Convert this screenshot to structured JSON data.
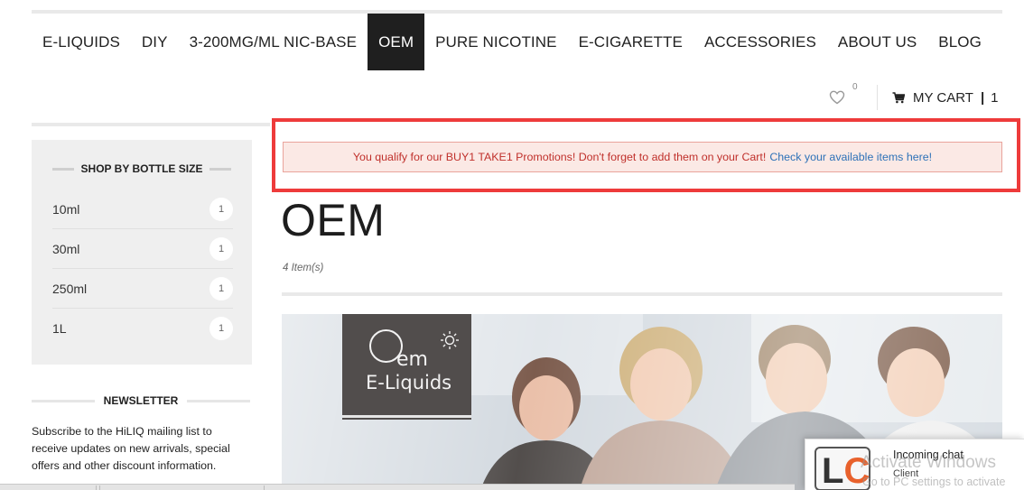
{
  "nav": {
    "items": [
      {
        "label": "E-LIQUIDS",
        "active": false
      },
      {
        "label": "DIY",
        "active": false
      },
      {
        "label": "3-200MG/ML NIC-BASE",
        "active": false
      },
      {
        "label": "OEM",
        "active": true
      },
      {
        "label": "PURE NICOTINE",
        "active": false
      },
      {
        "label": "E-CIGARETTE",
        "active": false
      },
      {
        "label": "ACCESSORIES",
        "active": false
      },
      {
        "label": "ABOUT US",
        "active": false
      },
      {
        "label": "BLOG",
        "active": false
      }
    ]
  },
  "header": {
    "wishlist_count": "0",
    "cart_label": "MY CART",
    "cart_count": "1"
  },
  "sidebar": {
    "title": "SHOP BY BOTTLE SIZE",
    "items": [
      {
        "label": "10ml",
        "count": "1"
      },
      {
        "label": "30ml",
        "count": "1"
      },
      {
        "label": "250ml",
        "count": "1"
      },
      {
        "label": "1L",
        "count": "1"
      }
    ]
  },
  "newsletter": {
    "title": "NEWSLETTER",
    "text": "Subscribe to the HiLIQ mailing list to receive updates on new arrivals, special offers and other discount information."
  },
  "promo": {
    "message": "You qualify for our BUY1 TAKE1 Promotions! Don't forget to add them on your Cart!",
    "link": "Check your available items here!"
  },
  "main": {
    "title": "OEM",
    "item_count": "4 Item(s)"
  },
  "banner": {
    "logo_letter": "O",
    "logo_em": "em",
    "logo_sub": "E-Liquids"
  },
  "chat": {
    "logo_l": "L",
    "logo_c": "C",
    "title": "Incoming chat",
    "subtitle": "Client"
  },
  "watermark": {
    "title": "Activate Windows",
    "subtitle": "Go to PC settings to activate"
  },
  "colors": {
    "nav_active_bg": "#1f1f1f",
    "promo_outline": "#ee3b3b",
    "promo_text": "#c0302b",
    "promo_link": "#2e72b8",
    "chat_accent": "#e8612c"
  }
}
